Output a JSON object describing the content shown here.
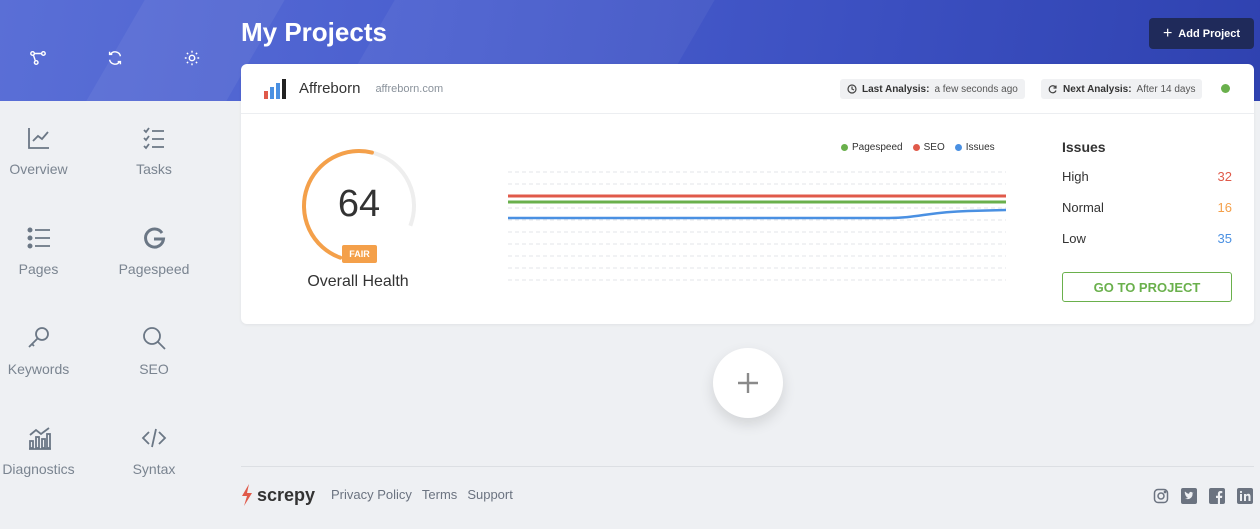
{
  "header": {
    "title": "My Projects",
    "add_project_label": "Add Project"
  },
  "sidebar": {
    "top_icons": [
      "network-icon",
      "refresh-icon",
      "settings-icon"
    ],
    "items": [
      {
        "label": "Overview",
        "icon": "line-chart-icon"
      },
      {
        "label": "Tasks",
        "icon": "checklist-icon"
      },
      {
        "label": "Pages",
        "icon": "list-icon"
      },
      {
        "label": "Pagespeed",
        "icon": "google-g-icon"
      },
      {
        "label": "Keywords",
        "icon": "key-icon"
      },
      {
        "label": "SEO",
        "icon": "search-icon"
      },
      {
        "label": "Diagnostics",
        "icon": "bar-analytics-icon"
      },
      {
        "label": "Syntax",
        "icon": "code-icon"
      }
    ]
  },
  "project": {
    "name": "Affreborn",
    "domain": "affreborn.com",
    "last_analysis_label": "Last Analysis:",
    "last_analysis_value": "a few seconds ago",
    "next_analysis_label": "Next Analysis:",
    "next_analysis_value": "After 14 days",
    "status_color": "#6ab04c",
    "health": {
      "score": "64",
      "score_fraction": 0.64,
      "rating": "FAIR",
      "label": "Overall Health"
    },
    "legend": [
      {
        "name": "Pagespeed",
        "color": "#6ab04c"
      },
      {
        "name": "SEO",
        "color": "#e05a4a"
      },
      {
        "name": "Issues",
        "color": "#4a90e2"
      }
    ],
    "issues": {
      "title": "Issues",
      "rows": [
        {
          "label": "High",
          "value": "32",
          "color": "#e05a4a"
        },
        {
          "label": "Normal",
          "value": "16",
          "color": "#f4a04a"
        },
        {
          "label": "Low",
          "value": "35",
          "color": "#4a90e2"
        }
      ]
    },
    "go_button_label": "GO TO PROJECT"
  },
  "footer": {
    "brand": "screpy",
    "links": [
      "Privacy Policy",
      "Terms",
      "Support"
    ],
    "socials": [
      "instagram-icon",
      "twitter-icon",
      "facebook-icon",
      "linkedin-icon"
    ]
  },
  "colors": {
    "accent": "#4a5fcf",
    "button_dark": "#1f2a5a",
    "fair": "#f4a04a"
  }
}
